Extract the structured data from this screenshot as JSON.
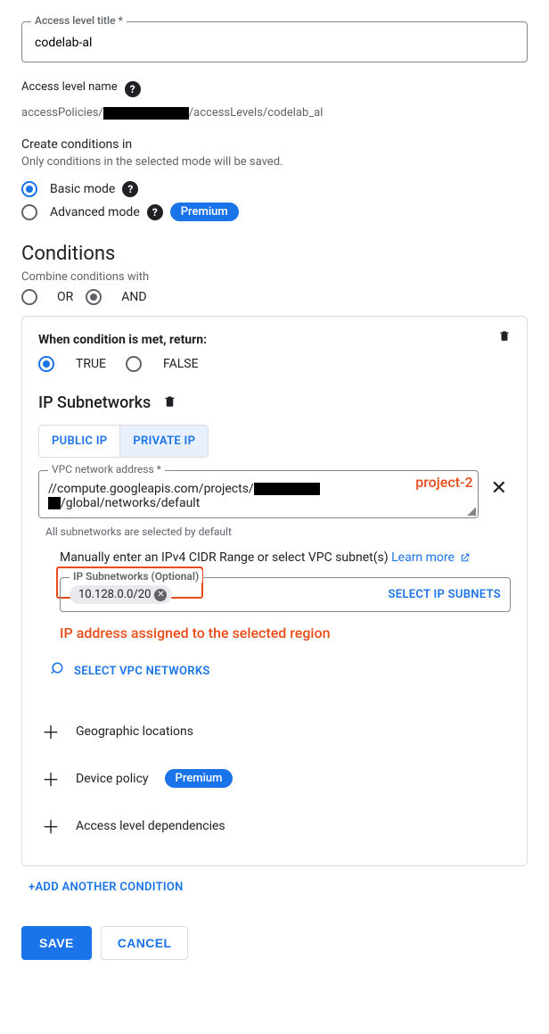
{
  "title_field": {
    "label": "Access level title *",
    "value": "codelab-al"
  },
  "access_name": {
    "label": "Access level name",
    "prefix": "accessPolicies/",
    "redacted": "██████████",
    "mid": "/accessLevels/",
    "suffix": "codelab_al"
  },
  "create_conditions": {
    "label": "Create conditions in",
    "hint": "Only conditions in the selected mode will be saved."
  },
  "modes": {
    "basic": "Basic mode",
    "advanced": "Advanced mode",
    "premium_chip": "Premium"
  },
  "conditions": {
    "heading": "Conditions",
    "combine_label": "Combine conditions with",
    "or": "OR",
    "and": "AND"
  },
  "condition_card": {
    "title": "When condition is met, return:",
    "true": "TRUE",
    "false": "FALSE",
    "ip_heading": "IP Subnetworks",
    "tab_public": "PUBLIC IP",
    "tab_private": "PRIVATE IP",
    "vpc_label": "VPC network address *",
    "vpc_line1": "//compute.googleapis.com/projects/",
    "vpc_line2": "/global/networks/default",
    "annotation_project": "project-2",
    "subnet_hint": "All subnetworks are selected by default",
    "manual_text": "Manually enter an IPv4 CIDR Range or select VPC subnet(s) ",
    "learn_more": "Learn more",
    "chip_label": "IP Subnetworks (Optional)",
    "chip_value": "10.128.0.0/20",
    "select_subnets": "SELECT IP SUBNETS",
    "annotation_ip": "IP address assigned to the selected region",
    "select_vpc": "SELECT VPC NETWORKS",
    "geo": "Geographic locations",
    "device_policy": "Device policy",
    "premium": "Premium",
    "deps": "Access level dependencies"
  },
  "add_condition": "+ADD ANOTHER CONDITION",
  "buttons": {
    "save": "SAVE",
    "cancel": "CANCEL"
  }
}
